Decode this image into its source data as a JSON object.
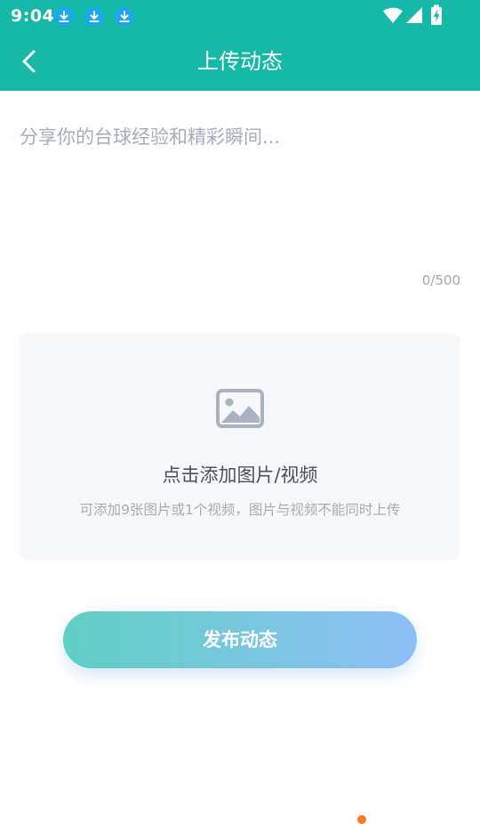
{
  "status_bar": {
    "time": "9:04",
    "notification_icons": [
      "download-icon",
      "download-icon",
      "download-icon"
    ],
    "system_icons": [
      "wifi-icon",
      "cell-signal-icon",
      "battery-charging-icon"
    ]
  },
  "app_bar": {
    "title": "上传动态",
    "back_icon": "chevron-left-icon"
  },
  "composer": {
    "placeholder": "分享你的台球经验和精彩瞬间...",
    "value": "",
    "char_count": "0/500"
  },
  "upload": {
    "icon": "image-icon",
    "title": "点击添加图片/视频",
    "subtitle": "可添加9张图片或1个视频，图片与视频不能同时上传"
  },
  "publish": {
    "label": "发布动态"
  },
  "colors": {
    "primary": "#16b9a8",
    "gradient_start": "#5fcfc3",
    "gradient_end": "#8fbef7",
    "upload_bg": "#f6f8fb",
    "download_badge": "#1aa7ec"
  }
}
